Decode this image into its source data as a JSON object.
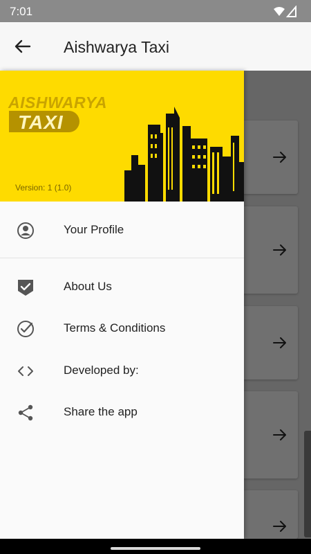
{
  "status_bar": {
    "time": "7:01"
  },
  "app_bar": {
    "title": "Aishwarya Taxi"
  },
  "drawer": {
    "header": {
      "brand_top": "AISHWARYA",
      "brand_bottom": "TAXI",
      "version": "Version: 1 (1.0)"
    },
    "items": [
      {
        "label": "Your Profile",
        "icon": "profile-icon"
      },
      {
        "label": "About Us",
        "icon": "shield-check-icon"
      },
      {
        "label": "Terms & Conditions",
        "icon": "check-circle-icon"
      },
      {
        "label": "Developed by:",
        "icon": "code-icon"
      },
      {
        "label": "Share the app",
        "icon": "share-icon"
      }
    ]
  },
  "colors": {
    "brand_yellow": "#fedb00",
    "scrim": "#666666"
  }
}
